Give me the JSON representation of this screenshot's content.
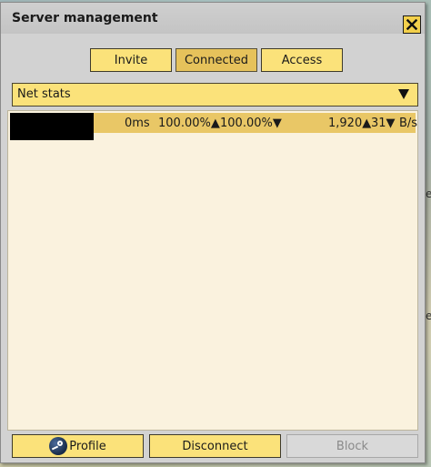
{
  "window": {
    "title": "Server management"
  },
  "tabs": [
    {
      "label": "Invite",
      "active": false
    },
    {
      "label": "Connected",
      "active": true
    },
    {
      "label": "Access",
      "active": false
    }
  ],
  "dropdown": {
    "selected": "Net stats"
  },
  "connections": [
    {
      "name": "[redacted]",
      "ping": "0ms",
      "up_percent": "100.00%",
      "down_percent": "100.00%",
      "upload_rate": "1,920",
      "download_rate": "31",
      "unit": "B/s"
    }
  ],
  "footer": {
    "profile_label": "Profile",
    "disconnect_label": "Disconnect",
    "block_label": "Block"
  },
  "colors": {
    "button": "#fbe27a",
    "button_active": "#e6c25b",
    "panel": "#faf2de",
    "row_highlight": "#e9c766"
  },
  "icons": {
    "close": "close-icon",
    "dropdown_arrow": "triangle-down-icon",
    "up": "triangle-up-icon",
    "down": "triangle-down-icon",
    "profile": "steam-icon"
  },
  "background": {
    "edge_glyph": "e"
  }
}
